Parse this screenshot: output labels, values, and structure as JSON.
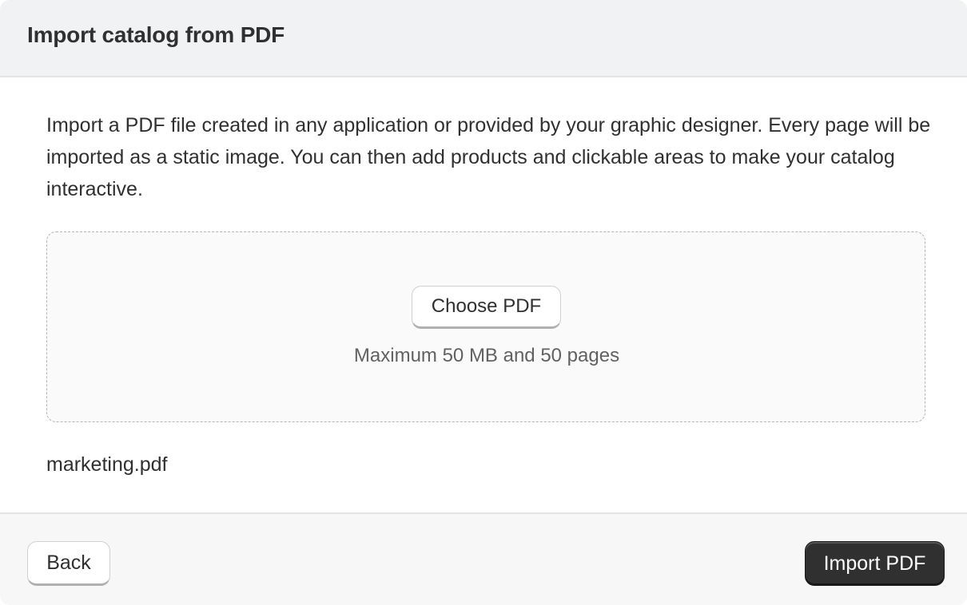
{
  "header": {
    "title": "Import catalog from PDF"
  },
  "body": {
    "description": "Import a PDF file created in any application or provided by your graphic designer. Every page will be imported as a static image. You can then add products and clickable areas to make your catalog interactive.",
    "dropzone": {
      "button_label": "Choose PDF",
      "hint": "Maximum 50 MB and 50 pages"
    },
    "selected_file": "marketing.pdf"
  },
  "footer": {
    "back_label": "Back",
    "import_label": "Import PDF"
  },
  "colors": {
    "primary_button": "#303030",
    "header_background": "#f1f2f4",
    "footer_background": "#f7f7f7"
  }
}
